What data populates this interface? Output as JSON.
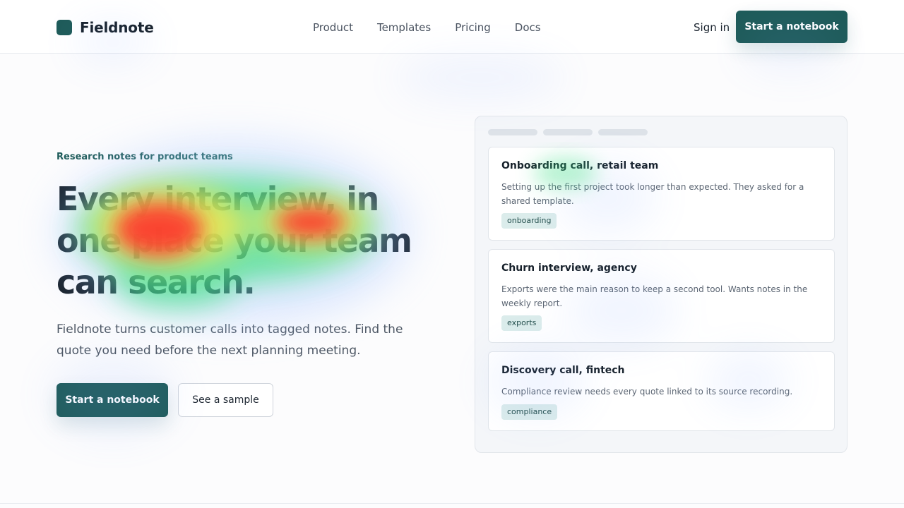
{
  "header": {
    "brand": "Fieldnote",
    "nav": [
      "Product",
      "Templates",
      "Pricing",
      "Docs"
    ],
    "sign_in": "Sign in",
    "cta": "Start a notebook"
  },
  "hero": {
    "eyebrow": "Research notes for product teams",
    "headline": "Every interview, in one place your team can search.",
    "subtext": "Fieldnote turns customer calls into tagged notes. Find the quote you need before the next planning meeting.",
    "primary_button": "Start a notebook",
    "secondary_button": "See a sample"
  },
  "notes": [
    {
      "title": "Onboarding call, retail team",
      "body": "Setting up the first project took longer than expected. They asked for a shared template.",
      "tag": "onboarding"
    },
    {
      "title": "Churn interview, agency",
      "body": "Exports were the main reason to keep a second tool. Wants notes in the weekly report.",
      "tag": "exports"
    },
    {
      "title": "Discovery call, fintech",
      "body": "Compliance review needs every quote linked to its source recording.",
      "tag": "compliance"
    }
  ],
  "colors": {
    "brand": "#1e5b59",
    "text": "#17212b",
    "tag_background": "#dbeceb",
    "heatmap_hot": "#ff2b2b",
    "heatmap_warm": "#ffe84a",
    "heatmap_cool": "#33e07a"
  }
}
